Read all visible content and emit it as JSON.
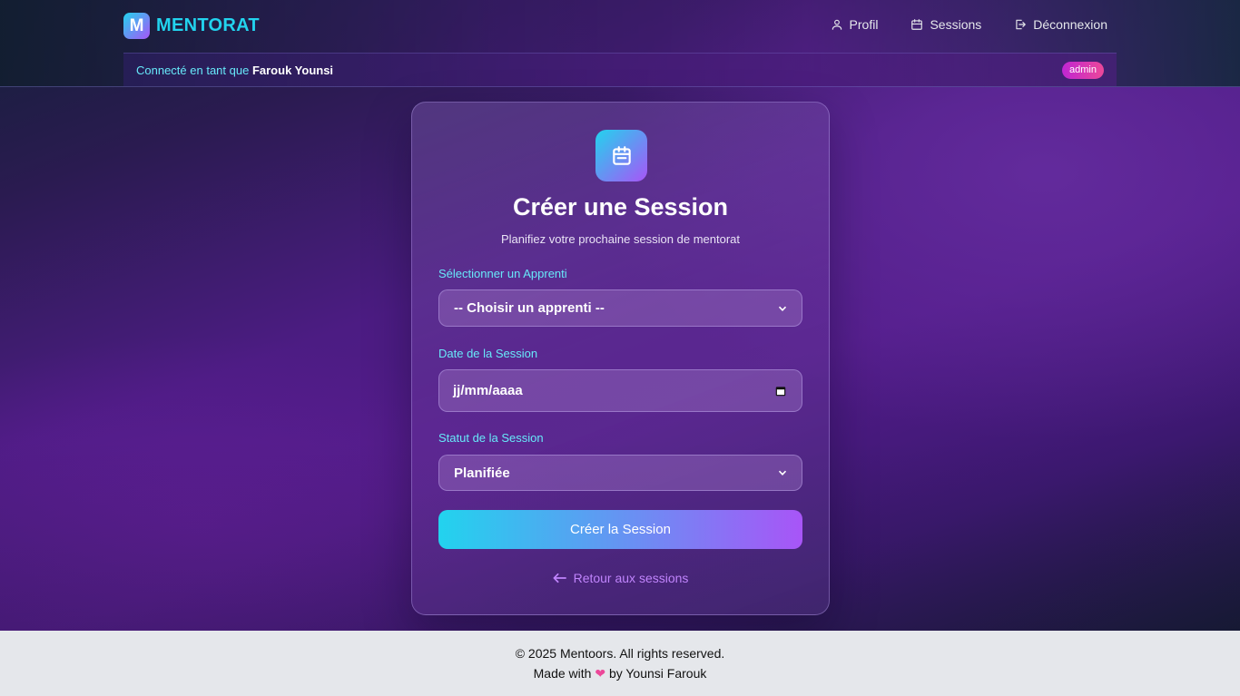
{
  "header": {
    "brand_logo_letter": "M",
    "brand_name": "MENTORAT",
    "nav": [
      {
        "label": "Profil",
        "icon": "user-icon"
      },
      {
        "label": "Sessions",
        "icon": "calendar-icon"
      },
      {
        "label": "Déconnexion",
        "icon": "logout-icon"
      }
    ]
  },
  "userbar": {
    "prefix": "Connecté en tant que",
    "username": "Farouk Younsi",
    "role_badge": "admin"
  },
  "form": {
    "icon": "calendar-icon",
    "title": "Créer une Session",
    "subtitle": "Planifiez votre prochaine session de mentorat",
    "apprenti_label": "Sélectionner un Apprenti",
    "apprenti_value": "-- Choisir un apprenti --",
    "date_label": "Date de la Session",
    "date_placeholder": "jj/mm/aaaa",
    "status_label": "Statut de la Session",
    "status_value": "Planifiée",
    "submit_label": "Créer la Session",
    "back_label": "Retour aux sessions"
  },
  "footer": {
    "copyright": "© 2025 Mentoors. All rights reserved.",
    "made_with_prefix": "Made with",
    "heart": "❤",
    "made_with_suffix": "by Younsi Farouk"
  },
  "colors": {
    "accent_cyan": "#22d3ee",
    "accent_purple": "#a855f7",
    "badge_pink": "#ec4899",
    "link_purple": "#c084fc"
  }
}
